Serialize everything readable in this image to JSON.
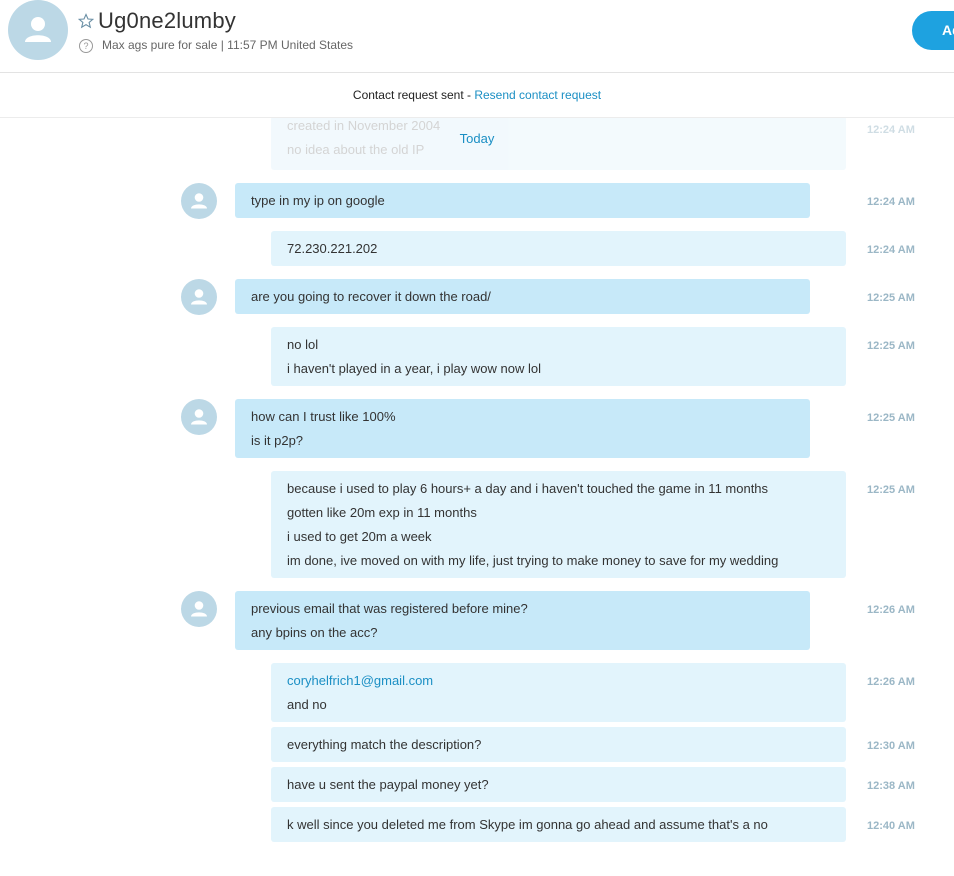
{
  "header": {
    "name": "Ug0ne2lumby",
    "mood": "Max ags pure for sale  |  11:57 PM United States",
    "add_button": "Add to Contacts",
    "colors": {
      "accent": "#1ea2e0",
      "avatar": "#bcd8e6"
    }
  },
  "request": {
    "text": "Contact request sent - ",
    "link": "Resend contact request"
  },
  "chat": {
    "date_divider": "Today",
    "faded": {
      "lines": [
        "created in November 2004",
        "no idea about the old IP"
      ],
      "time": "12:24 AM"
    },
    "messages": [
      {
        "dir": "in",
        "lines": [
          "type in my ip on google"
        ],
        "time": "12:24 AM"
      },
      {
        "dir": "out",
        "lines": [
          "72.230.221.202"
        ],
        "time": "12:24 AM"
      },
      {
        "dir": "in",
        "lines": [
          "are you going to recover it down the road/"
        ],
        "time": "12:25 AM"
      },
      {
        "dir": "out",
        "lines": [
          "no lol",
          "i haven't played in a year, i play wow now lol"
        ],
        "time": "12:25 AM"
      },
      {
        "dir": "in",
        "lines": [
          "how can I trust like 100%",
          "is it p2p?"
        ],
        "time": "12:25 AM"
      },
      {
        "dir": "out",
        "lines": [
          "because i used to play 6 hours+ a day and i haven't touched the game in 11 months",
          "gotten like 20m exp in 11 months",
          "i used to get 20m a week",
          "im done, ive moved on with my life, just trying to make money to save for my wedding"
        ],
        "time": "12:25 AM"
      },
      {
        "dir": "in",
        "lines": [
          "previous email that was registered before mine?",
          "any bpins on the acc?"
        ],
        "time": "12:26 AM"
      },
      {
        "dir": "out",
        "lines": [
          "coryhelfrich1@gmail.com",
          "and no"
        ],
        "time": "12:26 AM"
      },
      {
        "dir": "out",
        "lines": [
          "everything match the description?"
        ],
        "time": "12:30 AM"
      },
      {
        "dir": "out",
        "lines": [
          "have u sent the paypal money yet?"
        ],
        "time": "12:38 AM"
      },
      {
        "dir": "out",
        "lines": [
          "k well since you deleted me from Skype im gonna go ahead and assume that's a no"
        ],
        "time": "12:40 AM"
      }
    ]
  }
}
